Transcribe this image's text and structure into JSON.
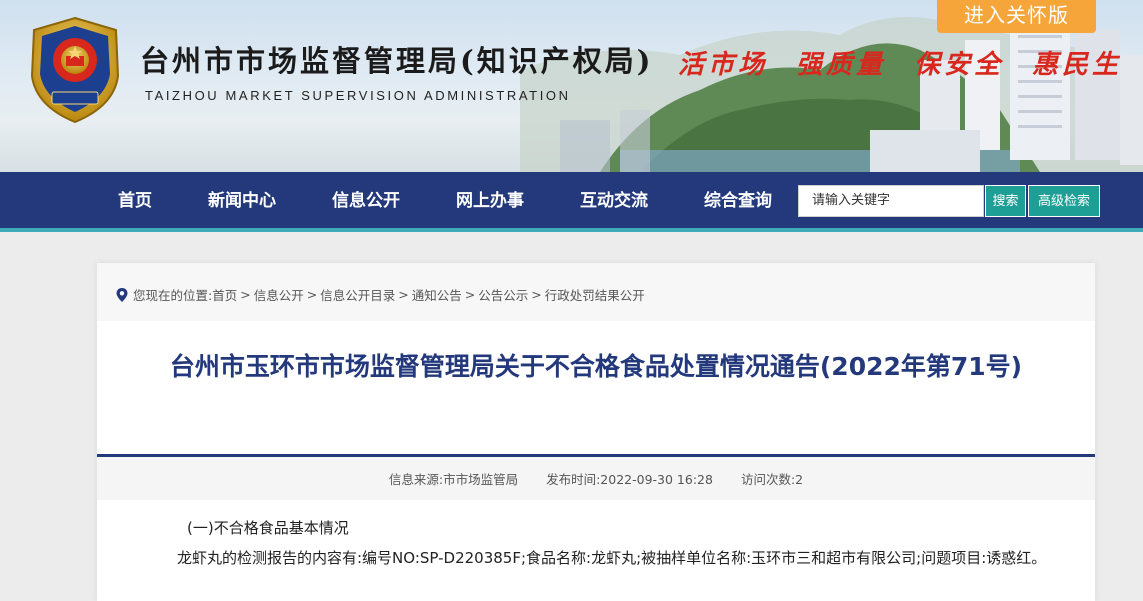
{
  "header": {
    "care_button": "进入关怀版",
    "site_title": "台州市市场监督管理局(知识产权局)",
    "site_subtitle": "TAIZHOU MARKET SUPERVISION ADMINISTRATION",
    "emblem_text": "市场监督管理",
    "slogans": [
      "活市场",
      "强质量",
      "保安全",
      "惠民生"
    ]
  },
  "nav": {
    "items": [
      "首页",
      "新闻中心",
      "信息公开",
      "网上办事",
      "互动交流",
      "综合查询"
    ],
    "search_placeholder": "请输入关键字",
    "search_button": "搜索",
    "advanced_button": "高级检索"
  },
  "breadcrumb": {
    "prefix": "您现在的位置:",
    "items": [
      "首页",
      "信息公开",
      "信息公开目录",
      "通知公告",
      "公告公示",
      "行政处罚结果公开"
    ],
    "separator": ">"
  },
  "article": {
    "title": "台州市玉环市市场监督管理局关于不合格食品处置情况通告(2022年第71号)",
    "meta": {
      "source": "信息来源:市市场监管局",
      "published": "发布时间:2022-09-30 16:28",
      "visits": "访问次数:2"
    },
    "section_heading": "(一)不合格食品基本情况",
    "paragraph": "龙虾丸的检测报告的内容有:编号NO:SP-D220385F;食品名称:龙虾丸;被抽样单位名称:玉环市三和超市有限公司;问题项目:诱惑红。"
  },
  "colors": {
    "nav_bg": "#23397c",
    "title_color": "#23397c",
    "slogan_red": "#d8271d",
    "care_orange": "#f5a53a",
    "button_teal": "#1e9f96"
  }
}
